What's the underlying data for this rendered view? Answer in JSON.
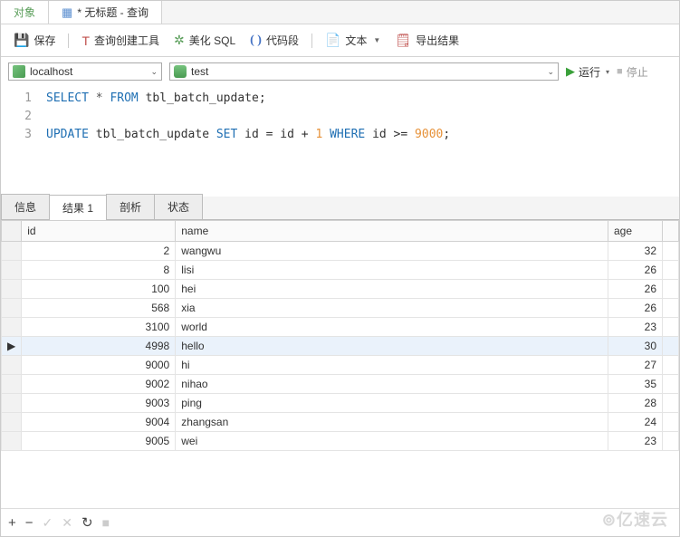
{
  "tabs": {
    "objects": "对象",
    "query": "* 无标题 - 查询"
  },
  "toolbar": {
    "save": "保存",
    "builder": "查询创建工具",
    "beautify": "美化 SQL",
    "snippet": "代码段",
    "text": "文本",
    "export": "导出结果"
  },
  "conn": {
    "host": "localhost",
    "db": "test",
    "run": "运行",
    "stop": "停止"
  },
  "sql": {
    "lines": [
      "1",
      "2",
      "3"
    ],
    "l1": {
      "select": "SELECT",
      "star": "*",
      "from": "FROM",
      "tbl": "tbl_batch_update;"
    },
    "l3": {
      "update": "UPDATE",
      "tbl": "tbl_batch_update",
      "set": "SET",
      "assign": "id = id + ",
      "one": "1",
      "where": "WHERE",
      "cond": "id >= ",
      "val": "9000",
      "semi": ";"
    }
  },
  "rtabs": {
    "info": "信息",
    "result": "结果 1",
    "profile": "剖析",
    "status": "状态"
  },
  "cols": {
    "id": "id",
    "name": "name",
    "age": "age"
  },
  "rows": [
    {
      "id": "2",
      "name": "wangwu",
      "age": "32"
    },
    {
      "id": "8",
      "name": "lisi",
      "age": "26"
    },
    {
      "id": "100",
      "name": "hei",
      "age": "26"
    },
    {
      "id": "568",
      "name": "xia",
      "age": "26"
    },
    {
      "id": "3100",
      "name": "world",
      "age": "23"
    },
    {
      "id": "4998",
      "name": "hello",
      "age": "30"
    },
    {
      "id": "9000",
      "name": "hi",
      "age": "27"
    },
    {
      "id": "9002",
      "name": "nihao",
      "age": "35"
    },
    {
      "id": "9003",
      "name": "ping",
      "age": "28"
    },
    {
      "id": "9004",
      "name": "zhangsan",
      "age": "24"
    },
    {
      "id": "9005",
      "name": "wei",
      "age": "23"
    }
  ],
  "watermark": "亿速云"
}
